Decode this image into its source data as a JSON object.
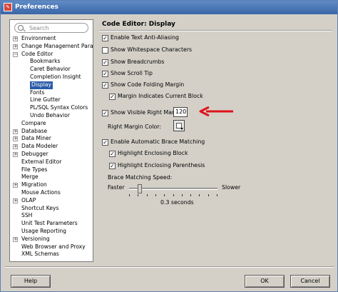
{
  "window": {
    "title": "Preferences"
  },
  "search": {
    "placeholder": "Search"
  },
  "tree": {
    "items": [
      {
        "label": "Environment",
        "expander": "+"
      },
      {
        "label": "Change Management Parameters",
        "expander": "+"
      },
      {
        "label": "Code Editor",
        "expander": "-"
      },
      {
        "label": "Bookmarks",
        "expander": ""
      },
      {
        "label": "Caret Behavior",
        "expander": ""
      },
      {
        "label": "Completion Insight",
        "expander": ""
      },
      {
        "label": "Display",
        "expander": "",
        "selected": true
      },
      {
        "label": "Fonts",
        "expander": ""
      },
      {
        "label": "Line Gutter",
        "expander": ""
      },
      {
        "label": "PL/SQL Syntax Colors",
        "expander": ""
      },
      {
        "label": "Undo Behavior",
        "expander": ""
      },
      {
        "label": "Compare",
        "expander": ""
      },
      {
        "label": "Database",
        "expander": "+"
      },
      {
        "label": "Data Miner",
        "expander": "+"
      },
      {
        "label": "Data Modeler",
        "expander": "+"
      },
      {
        "label": "Debugger",
        "expander": "+"
      },
      {
        "label": "External Editor",
        "expander": ""
      },
      {
        "label": "File Types",
        "expander": ""
      },
      {
        "label": "Merge",
        "expander": ""
      },
      {
        "label": "Migration",
        "expander": "+"
      },
      {
        "label": "Mouse Actions",
        "expander": ""
      },
      {
        "label": "OLAP",
        "expander": "+"
      },
      {
        "label": "Shortcut Keys",
        "expander": ""
      },
      {
        "label": "SSH",
        "expander": ""
      },
      {
        "label": "Unit Test Parameters",
        "expander": ""
      },
      {
        "label": "Usage Reporting",
        "expander": ""
      },
      {
        "label": "Versioning",
        "expander": "+"
      },
      {
        "label": "Web Browser and Proxy",
        "expander": ""
      },
      {
        "label": "XML Schemas",
        "expander": ""
      }
    ]
  },
  "page": {
    "title": "Code Editor: Display",
    "options": {
      "text_antialiasing": {
        "label": "Enable Text Anti-Aliasing",
        "checked": true
      },
      "whitespace": {
        "label": "Show Whitespace Characters",
        "checked": false
      },
      "breadcrumbs": {
        "label": "Show Breadcrumbs",
        "checked": true
      },
      "scroll_tip": {
        "label": "Show Scroll Tip",
        "checked": true
      },
      "code_folding": {
        "label": "Show Code Folding Margin",
        "checked": true
      },
      "margin_current_block": {
        "label": "Margin Indicates Current Block",
        "checked": true
      },
      "right_margin": {
        "label": "Show Visible Right Margin",
        "checked": true
      },
      "brace_matching": {
        "label": "Enable Automatic Brace Matching",
        "checked": true
      },
      "highlight_block": {
        "label": "Highlight Enclosing Block",
        "checked": true
      },
      "highlight_parenthesis": {
        "label": "Highlight Enclosing Parenthesis",
        "checked": true
      }
    },
    "right_margin_value": "120",
    "right_margin_color_label": "Right Margin Color:",
    "brace_speed": {
      "label": "Brace Matching Speed:",
      "min_label": "Faster",
      "max_label": "Slower",
      "value_text": "0.3 seconds",
      "position_fraction": 0.12
    }
  },
  "buttons": {
    "help": "Help",
    "ok": "OK",
    "cancel": "Cancel"
  },
  "colors": {
    "selection": "#2a5aa8",
    "annotation_arrow": "#e0141c",
    "titlebar": "#3a66a8"
  }
}
